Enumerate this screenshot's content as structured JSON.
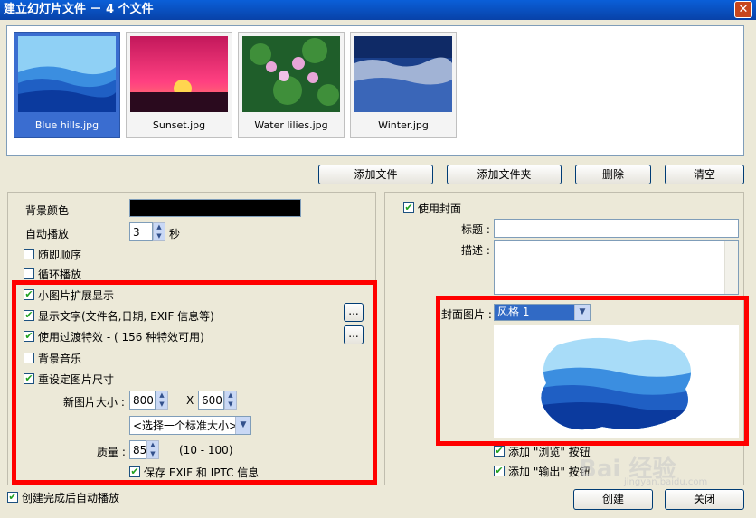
{
  "window": {
    "title": "建立幻灯片文件 － 4 个文件",
    "close_glyph": "✕"
  },
  "thumbnails": [
    {
      "name": "Blue hills.jpg",
      "selected": true
    },
    {
      "name": "Sunset.jpg",
      "selected": false
    },
    {
      "name": "Water lilies.jpg",
      "selected": false
    },
    {
      "name": "Winter.jpg",
      "selected": false
    }
  ],
  "file_buttons": {
    "add_file": "添加文件",
    "add_folder": "添加文件夹",
    "delete": "删除",
    "clear": "清空"
  },
  "left": {
    "bg_color_label": "背景颜色",
    "bg_color_value": "#000000",
    "autoplay_label": "自动播放",
    "autoplay_value": "3",
    "seconds_unit": "秒",
    "random_label": "随即顺序",
    "loop_label": "循环播放",
    "thumb_ext_label": "小图片扩展显示",
    "show_text_label": "显示文字(文件名,日期, EXIF 信息等)",
    "transition_label": "使用过渡特效 - ( 156 种特效可用)",
    "bg_music_label": "背景音乐",
    "resize_label": "重设定图片尺寸",
    "new_size_label": "新图片大小 :",
    "width_value": "800",
    "x_label": "X",
    "height_value": "600",
    "std_size_value": "<选择一个标准大小>",
    "quality_label": "质量 :",
    "quality_value": "85",
    "quality_range": "(10 - 100)",
    "keep_exif_label": "保存 EXIF 和 IPTC 信息",
    "ellipsis": "..."
  },
  "right": {
    "use_cover_label": "使用封面",
    "title_label": "标题 :",
    "title_value": "",
    "desc_label": "描述 :",
    "desc_value": "",
    "cover_image_label": "封面图片 :",
    "cover_style_value": "风格 1",
    "add_browse_label": "添加 \"浏览\" 按钮",
    "add_output_label": "添加 \"输出\" 按钮"
  },
  "bottom": {
    "autoplay_after_label": "创建完成后自动播放",
    "create": "创建",
    "close": "关闭"
  },
  "watermark": {
    "text": "Bai 经验",
    "url": "jingyan.baidu.com"
  },
  "colors": {
    "selection": "#3a6dd0",
    "highlight_box": "#ff0000",
    "title_bar": "#0a5fd8"
  }
}
